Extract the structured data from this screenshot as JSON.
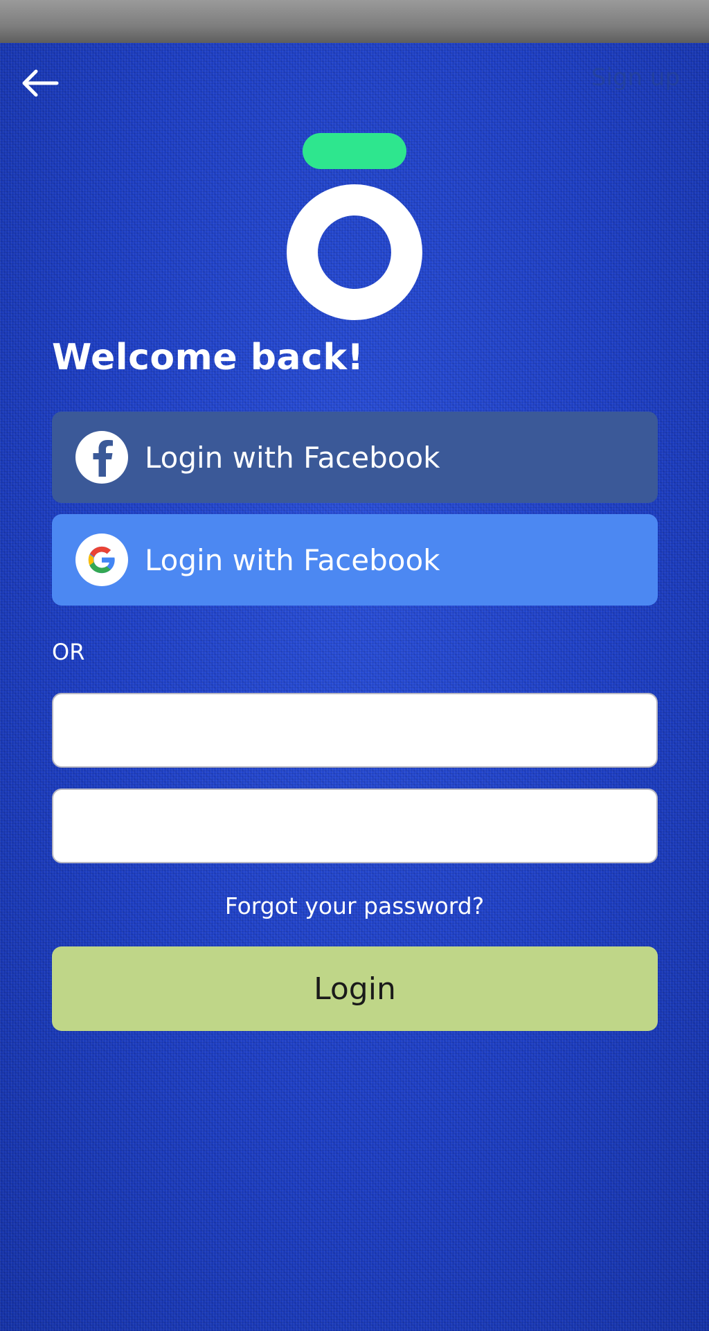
{
  "header": {
    "back_icon": "arrow-left-icon",
    "signup_label": "Sign up"
  },
  "logo": {
    "bar_color": "#2ee68e",
    "ring_color": "#ffffff"
  },
  "title": "Welcome back!",
  "social_buttons": [
    {
      "label": "Login with Facebook",
      "icon": "facebook-icon",
      "color": "#3b5998"
    },
    {
      "label": "Login with Facebook",
      "icon": "google-icon",
      "color": "#4c88f2"
    }
  ],
  "divider_label": "OR",
  "form": {
    "email_value": "",
    "email_placeholder": "",
    "password_value": "",
    "password_placeholder": "",
    "forgot_label": "Forgot your password?",
    "login_label": "Login",
    "login_color": "#bfd688"
  },
  "colors": {
    "background": "#1e3fc4",
    "status_bar": "#8a8a8a"
  }
}
